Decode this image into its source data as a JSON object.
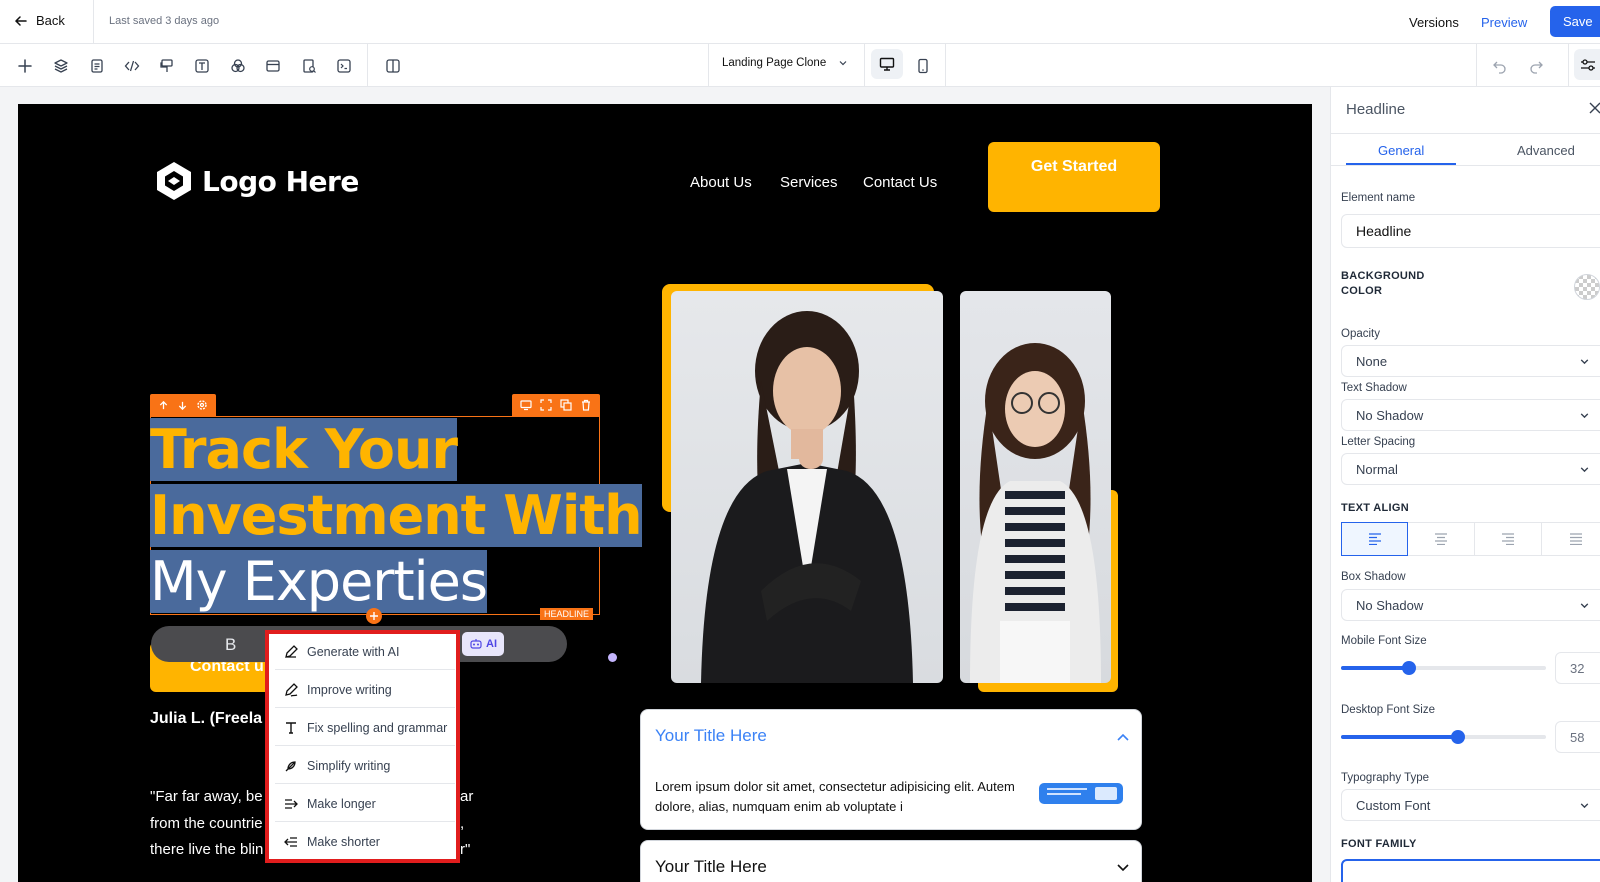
{
  "topbar": {
    "back_label": "Back",
    "last_saved": "Last saved 3 days ago",
    "versions_label": "Versions",
    "preview_label": "Preview",
    "save_label": "Save"
  },
  "toolbar": {
    "page_select": "Landing Page Clone"
  },
  "canvas": {
    "logo_text": "Logo Here",
    "nav": [
      "About Us",
      "Services",
      "Contact Us"
    ],
    "cta_label": "Get Started",
    "headline_line1": "Track Your",
    "headline_line2": "Investment With",
    "headline_line3": "My Experties",
    "headline_tag": "HEADLINE",
    "format_bold": "B",
    "ai_badge": "AI",
    "contact_button": "Contact u",
    "author": "Julia L. (Freela",
    "quote_lines": [
      "\"Far far away, be",
      "from the countrie",
      "there live the blin"
    ],
    "quote_tails": [
      "ar",
      ",",
      "r\""
    ],
    "accordion_title": "Your Title Here",
    "accordion_body": "Lorem ipsum dolor sit amet, consectetur adipisicing elit. Autem dolore, alias, numquam enim ab voluptate i",
    "accordion_title2": "Your Title Here",
    "accent_color": "#ffb400",
    "selection_color": "#f97316"
  },
  "ai_menu": {
    "items": [
      "Generate with AI",
      "Improve writing",
      "Fix spelling and grammar",
      "Simplify writing",
      "Make longer",
      "Make shorter"
    ]
  },
  "panel": {
    "title": "Headline",
    "tabs": [
      "General",
      "Advanced"
    ],
    "element_name_label": "Element name",
    "element_name_value": "Headline",
    "bg_color_label": "BACKGROUND COLOR",
    "opacity_label": "Opacity",
    "opacity_value": "None",
    "text_shadow_label": "Text Shadow",
    "text_shadow_value": "No Shadow",
    "letter_spacing_label": "Letter Spacing",
    "letter_spacing_value": "Normal",
    "text_align_label": "TEXT ALIGN",
    "box_shadow_label": "Box Shadow",
    "box_shadow_value": "No Shadow",
    "mobile_font_label": "Mobile Font Size",
    "mobile_font_value": "32",
    "mobile_font_fraction": 0.33,
    "desktop_font_label": "Desktop Font Size",
    "desktop_font_value": "58",
    "desktop_font_fraction": 0.57,
    "typography_label": "Typography Type",
    "typography_value": "Custom Font",
    "font_family_label": "FONT FAMILY",
    "accent_color": "#2563eb"
  }
}
